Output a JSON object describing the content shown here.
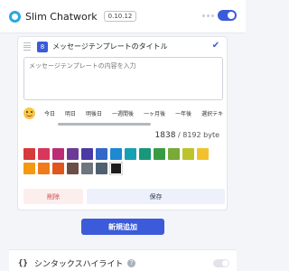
{
  "app": {
    "title": "Slim Chatwork",
    "version": "0.10.12"
  },
  "template": {
    "index": "8",
    "title": "メッセージテンプレートのタイトル",
    "placeholder": "メッセージテンプレートの内容を入力",
    "chips": [
      "今日",
      "明日",
      "明後日",
      "一週間後",
      "一ヶ月後",
      "一年後",
      "選択テキ"
    ],
    "bytes_used": "1838",
    "bytes_total": "/ 8192 byte",
    "colors": [
      "#d63a3a",
      "#d9365c",
      "#bb2d74",
      "#6b3a96",
      "#4b3aa3",
      "#3468c9",
      "#1e88d2",
      "#16a1b2",
      "#19977a",
      "#3a9b45",
      "#78aa38",
      "#bcc42c",
      "#f3c12e",
      "#f39a12",
      "#ef7b1a",
      "#e0561d",
      "#6b4f45",
      "#6e757f",
      "#4f6170",
      "#1d1d1f"
    ],
    "selected_color": "#1d1d1f",
    "delete_label": "削除",
    "save_label": "保存"
  },
  "add_button_label": "新規追加",
  "section": {
    "icon_text": "{}",
    "title": "シンタックスハイライト",
    "help": "?"
  }
}
